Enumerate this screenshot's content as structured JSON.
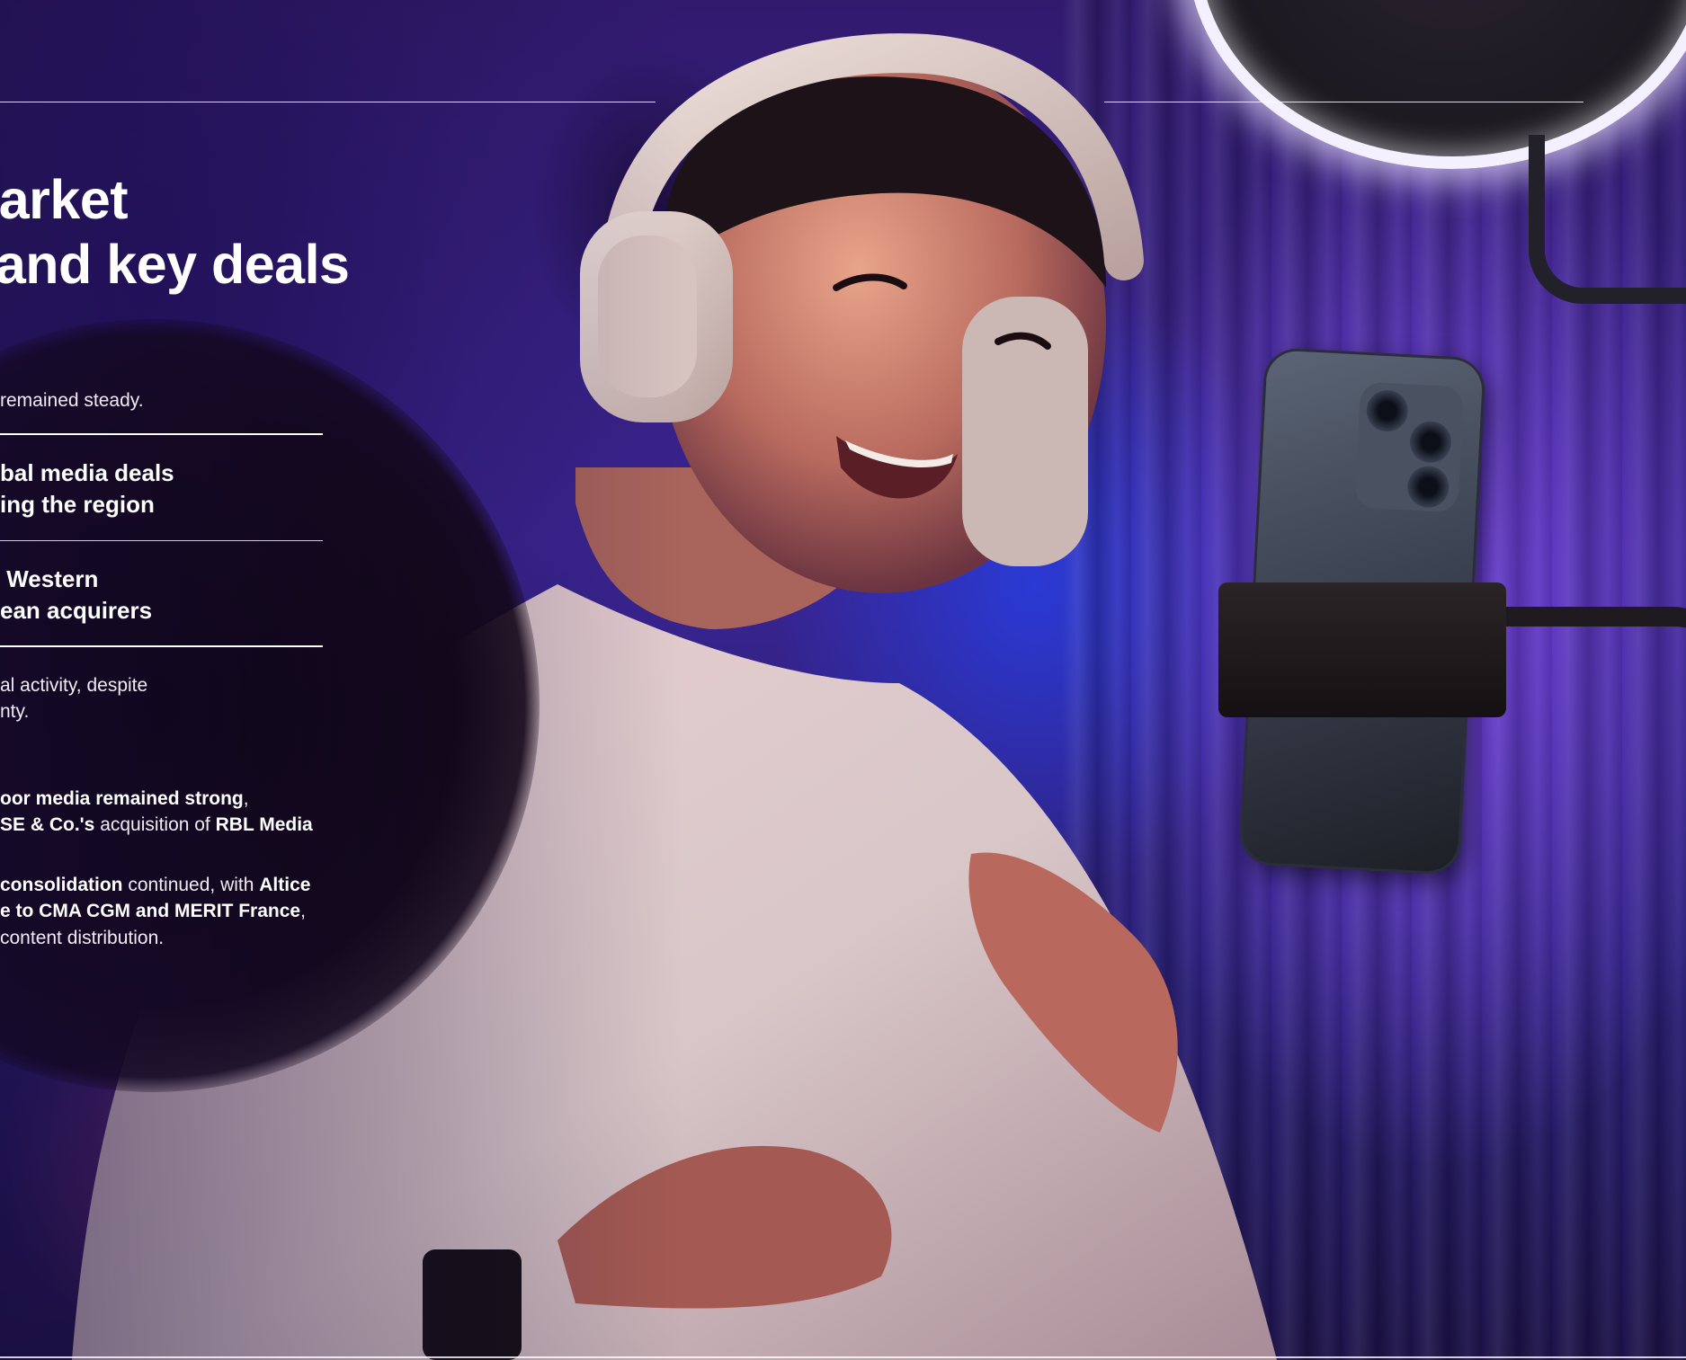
{
  "photo": {
    "alt": "",
    "subject": "person-with-headphones",
    "accent_colors": [
      "#3a2490",
      "#7a46e6",
      "#be3c78",
      "#f4f0ff"
    ]
  },
  "headline": {
    "line1": "market",
    "line2": "y and key deals"
  },
  "intro": {
    "text": "remained steady."
  },
  "highlights": [
    {
      "line1": "bal media deals",
      "line2": "ing the region"
    },
    {
      "line1": " Western",
      "line2": "ean acquirers"
    }
  ],
  "body": {
    "p1_line1": "al activity, despite",
    "p1_line2": "nty.",
    "p2_line1_bold": "oor media remained strong",
    "p2_line1_rest": ",",
    "p2_line2_bold1": "SE & Co.'s",
    "p2_line2_mid": " acquisition of ",
    "p2_line2_bold2": "RBL Media",
    "p3_line1_bold": "consolidation",
    "p3_line1_mid": " continued, with ",
    "p3_line1_bold2": "Altice",
    "p3_line2_bold": "e to CMA CGM and MERIT France",
    "p3_line2_rest": ",",
    "p3_line3": " content distribution."
  }
}
